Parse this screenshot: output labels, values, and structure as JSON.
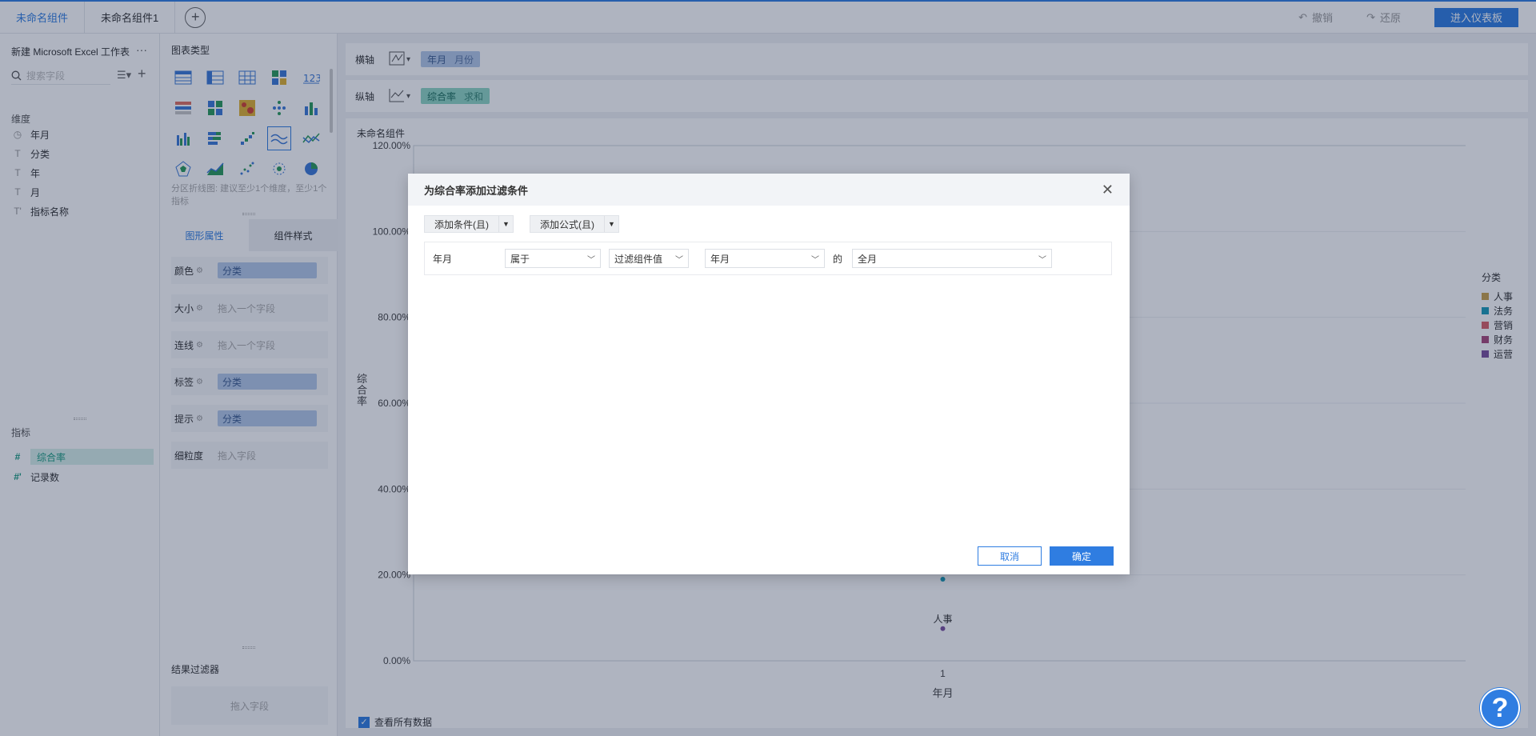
{
  "tabs": [
    {
      "label": "未命名组件",
      "active": true
    },
    {
      "label": "未命名组件1",
      "active": false
    }
  ],
  "toolbar": {
    "undo_label": "撤销",
    "redo_label": "还原",
    "enter_dashboard_label": "进入仪表板"
  },
  "fields": {
    "dataset_name": "新建 Microsoft Excel 工作表",
    "search_placeholder": "搜索字段",
    "dimensions_title": "维度",
    "dimensions": [
      {
        "label": "年月",
        "icon": "clock-icon"
      },
      {
        "label": "分类",
        "icon": "text-icon"
      },
      {
        "label": "年",
        "icon": "text-icon"
      },
      {
        "label": "月",
        "icon": "text-icon"
      },
      {
        "label": "指标名称",
        "icon": "text-icon"
      }
    ],
    "measures_title": "指标",
    "measures": [
      {
        "label": "综合率",
        "selected": true
      },
      {
        "label": "记录数",
        "selected": false
      }
    ]
  },
  "config": {
    "chart_type_title": "图表类型",
    "chart_type_hint": "分区折线图: 建议至少1个维度，至少1个指标",
    "prop_tab_graph": "图形属性",
    "prop_tab_style": "组件样式",
    "props": [
      {
        "label": "颜色",
        "value": "分类",
        "filled": true
      },
      {
        "label": "大小",
        "value": "拖入一个字段",
        "filled": false
      },
      {
        "label": "连线",
        "value": "拖入一个字段",
        "filled": false
      },
      {
        "label": "标签",
        "value": "分类",
        "filled": true
      },
      {
        "label": "提示",
        "value": "分类",
        "filled": true
      },
      {
        "label": "细粒度",
        "value": "拖入字段",
        "filled": false
      }
    ],
    "result_filter_title": "结果过滤器",
    "result_filter_placeholder": "拖入字段"
  },
  "axes": {
    "x_label": "横轴",
    "x_field": "年月",
    "x_sub": "月份",
    "y_label": "纵轴",
    "y_field": "综合率",
    "y_sub": "求和"
  },
  "chart": {
    "title": "未命名组件",
    "show_all_label": "查看所有数据"
  },
  "chart_data": {
    "type": "scatter",
    "title": "未命名组件",
    "xlabel": "年月",
    "ylabel": "综合率",
    "categories": [
      "1"
    ],
    "y_ticks": [
      "0.00%",
      "20.00%",
      "40.00%",
      "60.00%",
      "80.00%",
      "100.00%",
      "120.00%"
    ],
    "ylim": [
      0,
      1.2
    ],
    "legend_title": "分类",
    "legend_position": "right",
    "series": [
      {
        "name": "人事",
        "color": "#c9a24b",
        "values": []
      },
      {
        "name": "法务",
        "color": "#1a9bb8",
        "values": [
          0.19
        ]
      },
      {
        "name": "营销",
        "color": "#d9606a",
        "values": []
      },
      {
        "name": "财务",
        "color": "#a8487a",
        "values": []
      },
      {
        "name": "运营",
        "color": "#7a4f9e",
        "values": [
          0.075
        ]
      }
    ],
    "point_labels": [
      {
        "text": "人事",
        "x": "1",
        "y": 0.075
      }
    ]
  },
  "dialog": {
    "title": "为综合率添加过滤条件",
    "add_condition": "添加条件(且)",
    "add_formula": "添加公式(且)",
    "condition": {
      "field": "年月",
      "operator": "属于",
      "value_type": "过滤组件值",
      "component_field": "年月",
      "of_text": "的",
      "granularity": "全月"
    },
    "cancel_label": "取消",
    "ok_label": "确定"
  },
  "help_label": "?",
  "colors": {
    "accent": "#2f7de1",
    "measure": "#1a9c80"
  }
}
